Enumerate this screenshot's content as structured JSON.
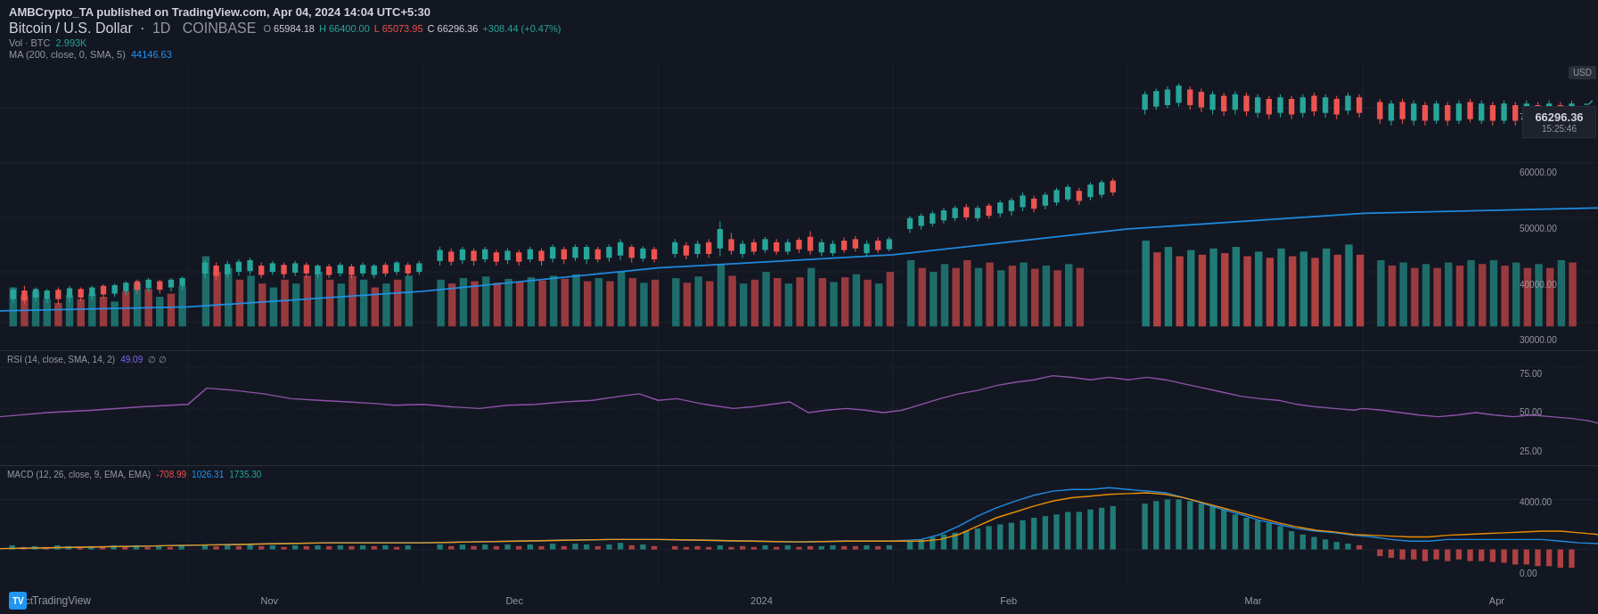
{
  "header": {
    "publisher": "AMBCrypto_TA published on TradingView.com, Apr 04, 2024 14:04 UTC+5:30",
    "pair": "Bitcoin / U.S. Dollar",
    "timeframe": "1D",
    "exchange": "COINBASE",
    "open_label": "O",
    "open_val": "65984.18",
    "high_label": "H",
    "high_val": "66400.00",
    "low_label": "L",
    "low_val": "65073.95",
    "close_label": "C",
    "close_val": "66296.36",
    "change": "+308.44 (+0.47%)",
    "vol_label": "Vol · BTC",
    "vol_val": "2.993K",
    "ma_label": "MA (200, close, 0, SMA, 5)",
    "ma_val": "44146.63",
    "rsi_label": "RSI (14, close, SMA, 14, 2)",
    "rsi_val": "49.09",
    "macd_label": "MACD (12, 26, close, 9, EMA, EMA)",
    "macd_val": "-708.99",
    "signal_val": "1026.31",
    "hist_val": "1735.30",
    "price_display": "66296.36",
    "time_display": "15:25:46",
    "currency": "USD"
  },
  "x_axis": {
    "labels": [
      "Oct",
      "Nov",
      "Dec",
      "2024",
      "Feb",
      "Mar",
      "Apr"
    ]
  },
  "y_axis_price": {
    "labels": [
      "70000.00",
      "60000.00",
      "50000.00",
      "40000.00",
      "30000.00"
    ]
  },
  "y_axis_rsi": {
    "labels": [
      "75.00",
      "50.00",
      "25.00"
    ]
  },
  "y_axis_macd": {
    "labels": [
      "4000.00",
      "0.00"
    ]
  },
  "colors": {
    "background": "#131722",
    "bull": "#26a69a",
    "bear": "#ef5350",
    "ma_line": "#2196F3",
    "rsi_line": "#9b59b6",
    "macd_line": "#2196F3",
    "signal_line": "#FF9800",
    "grid": "#2a2e39",
    "text": "#9598a1"
  },
  "tradingview": {
    "logo_text": "TradingView"
  }
}
